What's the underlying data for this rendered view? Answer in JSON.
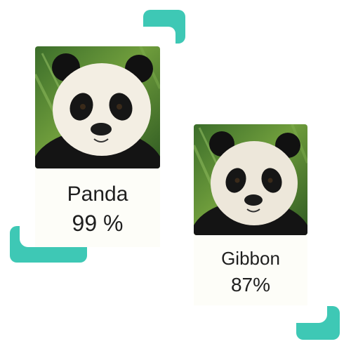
{
  "accent_color": "#3ec8b5",
  "cards": [
    {
      "name": "Panda",
      "confidence": "99 %"
    },
    {
      "name": "Gibbon",
      "confidence": "87%"
    }
  ]
}
